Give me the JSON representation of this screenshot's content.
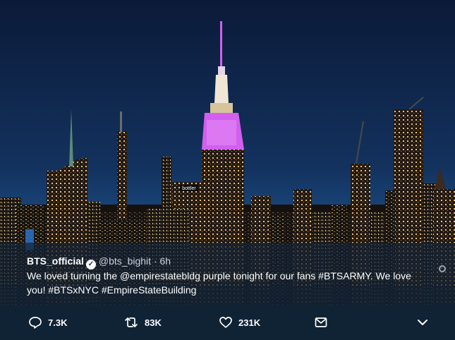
{
  "tweet": {
    "display_name": "BTS_official",
    "handle": "@bts_bighit",
    "separator": "·",
    "time": "6h",
    "text": "We loved turning the @empirestatebldg purple tonight for our fans #BTSARMY. We love you! #BTSxNYC #EmpireStateBuilding"
  },
  "actions": {
    "reply_count": "7.3K",
    "retweet_count": "83K",
    "like_count": "231K"
  },
  "photo": {
    "sign_text": "bottler",
    "spire_highlight_color": "#d25ff0",
    "sky_top_color": "#0b1a38",
    "sky_bottom_color": "#1c4f86"
  }
}
